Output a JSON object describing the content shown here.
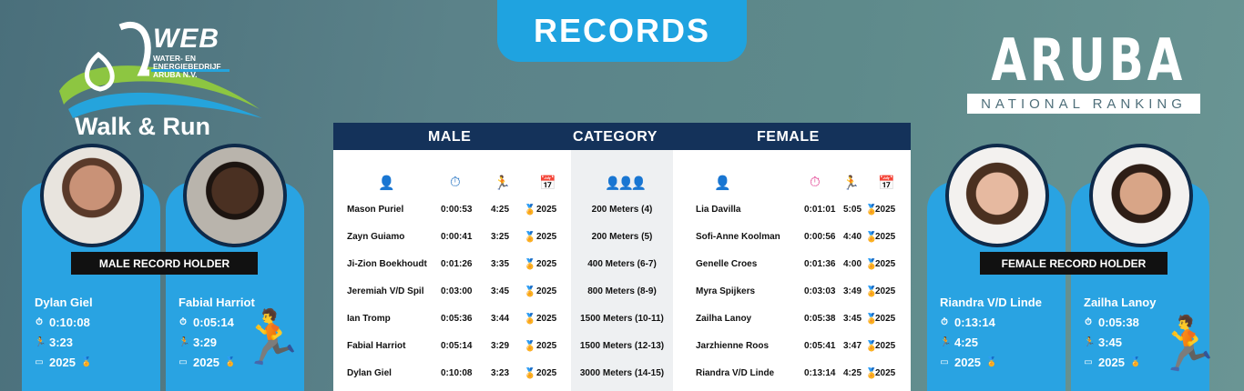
{
  "banner": {
    "title": "RECORDS"
  },
  "logo": {
    "brand": "WEB",
    "line1": "WATER- EN",
    "line2": "ENERGIEBEDRIJF",
    "line3": "ARUBA N.V.",
    "event": "Walk & Run"
  },
  "ranking": {
    "country": "ARUBA",
    "subtitle": "NATIONAL RANKING"
  },
  "male_label": "MALE RECORD HOLDER",
  "female_label": "FEMALE RECORD HOLDER",
  "holders": [
    {
      "name": "Dylan Giel",
      "time": "0:10:08",
      "pace": "3:23",
      "year": "2025"
    },
    {
      "name": "Fabial Harriot",
      "time": "0:05:14",
      "pace": "3:29",
      "year": "2025"
    },
    {
      "name": "Riandra V/D Linde",
      "time": "0:13:14",
      "pace": "4:25",
      "year": "2025"
    },
    {
      "name": "Zailha Lanoy",
      "time": "0:05:38",
      "pace": "3:45",
      "year": "2025"
    }
  ],
  "table": {
    "headers": {
      "male": "MALE",
      "category": "CATEGORY",
      "female": "FEMALE"
    },
    "rows": [
      {
        "m_name": "Mason Puriel",
        "m_time": "0:00:53",
        "m_pace": "4:25",
        "m_year": "2025",
        "category": "200 Meters (4)",
        "f_name": "Lia Davilla",
        "f_time": "0:01:01",
        "f_pace": "5:05",
        "f_year": "2025"
      },
      {
        "m_name": "Zayn Guiamo",
        "m_time": "0:00:41",
        "m_pace": "3:25",
        "m_year": "2025",
        "category": "200 Meters (5)",
        "f_name": "Sofi-Anne Koolman",
        "f_time": "0:00:56",
        "f_pace": "4:40",
        "f_year": "2025"
      },
      {
        "m_name": "Ji-Zion Boekhoudt",
        "m_time": "0:01:26",
        "m_pace": "3:35",
        "m_year": "2025",
        "category": "400 Meters (6-7)",
        "f_name": "Genelle Croes",
        "f_time": "0:01:36",
        "f_pace": "4:00",
        "f_year": "2025"
      },
      {
        "m_name": "Jeremiah V/D Spil",
        "m_time": "0:03:00",
        "m_pace": "3:45",
        "m_year": "2025",
        "category": "800 Meters (8-9)",
        "f_name": "Myra Spijkers",
        "f_time": "0:03:03",
        "f_pace": "3:49",
        "f_year": "2025"
      },
      {
        "m_name": "Ian Tromp",
        "m_time": "0:05:36",
        "m_pace": "3:44",
        "m_year": "2025",
        "category": "1500 Meters (10-11)",
        "f_name": "Zailha Lanoy",
        "f_time": "0:05:38",
        "f_pace": "3:45",
        "f_year": "2025"
      },
      {
        "m_name": "Fabial Harriot",
        "m_time": "0:05:14",
        "m_pace": "3:29",
        "m_year": "2025",
        "category": "1500 Meters (12-13)",
        "f_name": "Jarzhienne Roos",
        "f_time": "0:05:41",
        "f_pace": "3:47",
        "f_year": "2025"
      },
      {
        "m_name": "Dylan Giel",
        "m_time": "0:10:08",
        "m_pace": "3:23",
        "m_year": "2025",
        "category": "3000 Meters (14-15)",
        "f_name": "Riandra V/D Linde",
        "f_time": "0:13:14",
        "f_pace": "4:25",
        "f_year": "2025"
      }
    ]
  },
  "icons": {
    "person": "person-icon",
    "stopwatch": "stopwatch-icon",
    "runner": "runner-icon",
    "calendar": "calendar-icon",
    "medal": "medal-icon",
    "group": "group-icon"
  },
  "colors": {
    "accent": "#29a3e2",
    "navy": "#14325a",
    "male": "#1e6fc0",
    "female": "#e0378c"
  }
}
